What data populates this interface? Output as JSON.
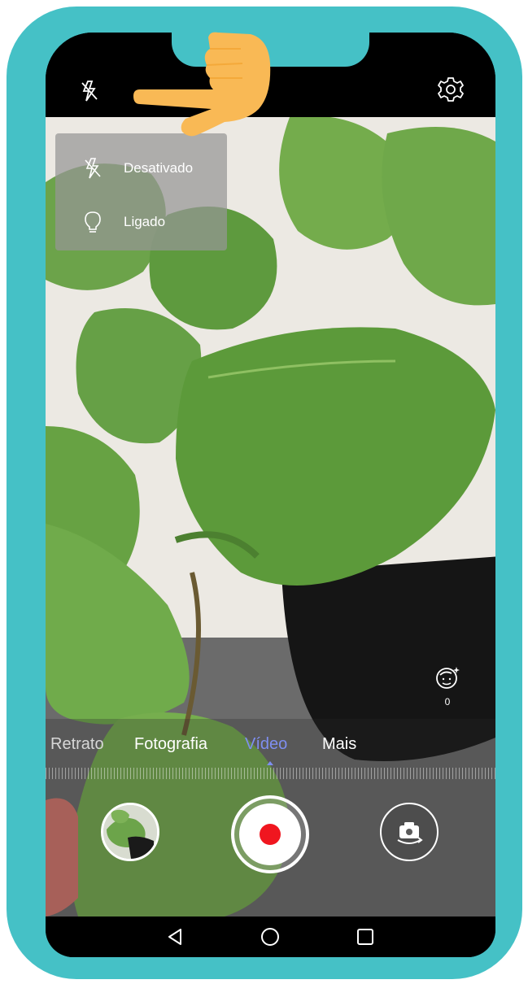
{
  "top_bar": {
    "flash_icon": "flash-off-icon",
    "settings_icon": "gear-icon"
  },
  "flash_menu": {
    "items": [
      {
        "label": "Desativado",
        "icon": "flash-off-icon"
      },
      {
        "label": "Ligado",
        "icon": "bulb-icon"
      }
    ]
  },
  "beauty": {
    "icon": "beauty-face-icon",
    "value": "0"
  },
  "modes": [
    {
      "label": "Retrato"
    },
    {
      "label": "Fotografia"
    },
    {
      "label": "Vídeo",
      "active": true
    },
    {
      "label": "Mais"
    }
  ],
  "controls": {
    "gallery_icon": "gallery-thumbnail",
    "record_icon": "record-icon",
    "switch_icon": "switch-camera-icon"
  },
  "nav": {
    "back_icon": "back-triangle-icon",
    "home_icon": "home-circle-icon",
    "recents_icon": "recents-square-icon"
  },
  "colors": {
    "frame": "#45c1c6",
    "active_mode": "#7e8ef0",
    "record": "#f0161f",
    "hand": "#f9b955"
  }
}
